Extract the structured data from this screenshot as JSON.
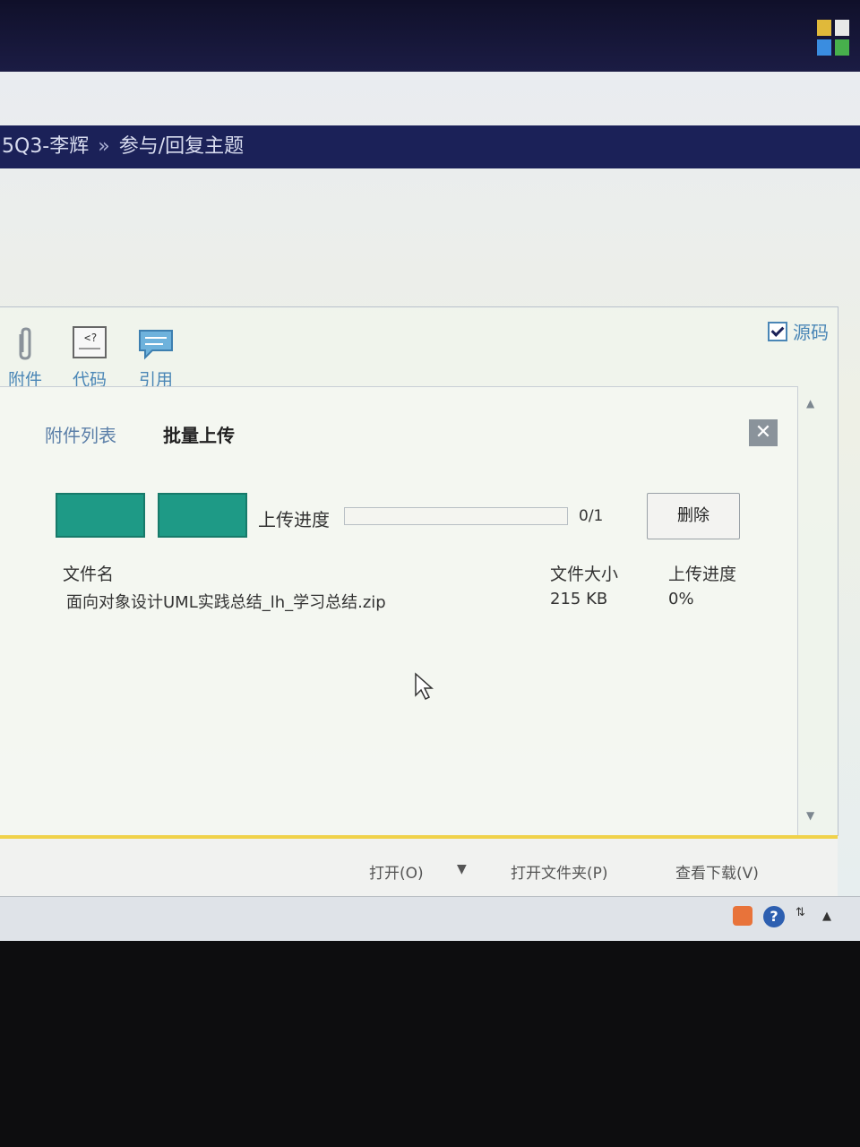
{
  "breadcrumb": {
    "course": "5Q3-李辉",
    "separator": "»",
    "current": "参与/回复主题"
  },
  "toolbar": {
    "attachment_label": "附件",
    "code_label": "代码",
    "quote_label": "引用",
    "source_label": "源码",
    "source_checked": true
  },
  "upload_dialog": {
    "tab_list": "附件列表",
    "tab_batch": "批量上传",
    "progress_label": "上传进度",
    "progress_count": "0/1",
    "progress_fraction": 0,
    "delete_label": "删除",
    "columns": {
      "name": "文件名",
      "size": "文件大小",
      "progress": "上传进度"
    },
    "files": [
      {
        "name": "面向对象设计UML实践总结_lh_学习总结.zip",
        "size": "215 KB",
        "progress": "0%"
      }
    ]
  },
  "download_bar": {
    "open": "打开(O)",
    "open_folder": "打开文件夹(P)",
    "view_downloads": "查看下载(V)"
  },
  "colors": {
    "header": "#1b2158",
    "accent_green": "#1e9a86",
    "link_blue": "#4a86b6",
    "download_bar_border": "#f0d24a"
  }
}
